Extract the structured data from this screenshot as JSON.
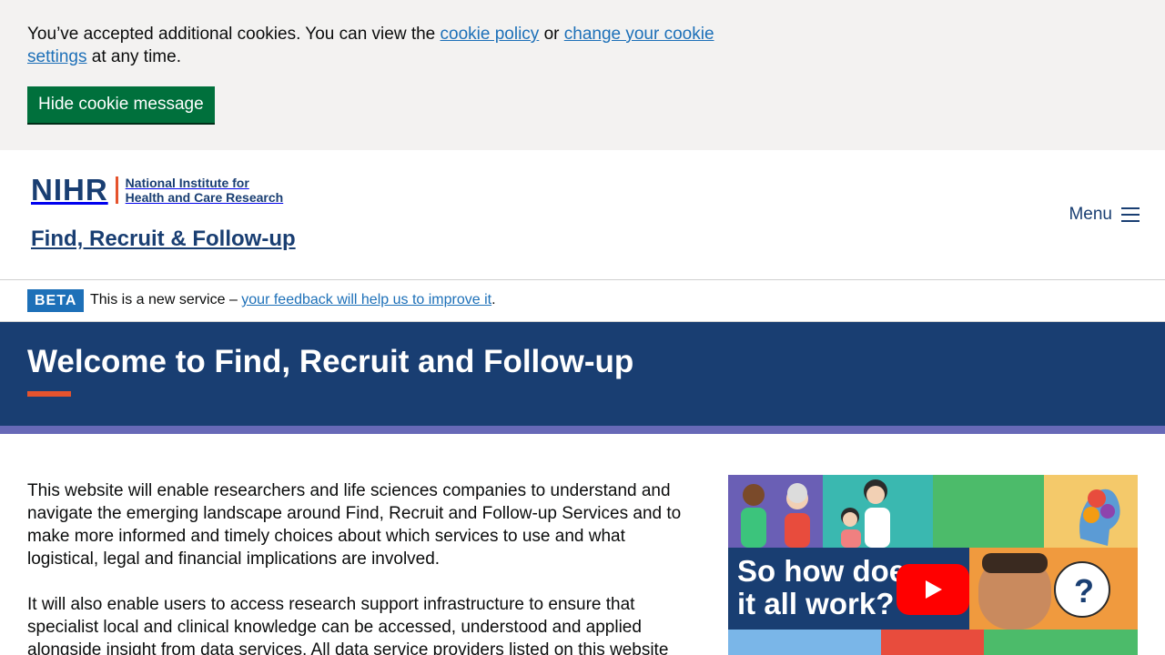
{
  "cookie_banner": {
    "text_before": "You’ve accepted additional cookies. You can view the ",
    "policy_link": "cookie policy",
    "text_middle": " or ",
    "settings_link": "change your cookie settings",
    "text_after": " at any time.",
    "hide_button": "Hide cookie message"
  },
  "header": {
    "logo_mark": "NIHR",
    "logo_line1": "National Institute for",
    "logo_line2": "Health and Care Research",
    "service_name": "Find, Recruit & Follow-up",
    "menu_label": "Menu"
  },
  "beta": {
    "tag": "BETA",
    "text": "This is a new service – ",
    "link": "your feedback will help us to improve it",
    "text_after": "."
  },
  "hero": {
    "title": "Welcome to Find, Recruit and Follow-up"
  },
  "main": {
    "paragraph1": "This website will enable researchers and life sciences companies to understand and navigate the emerging landscape around Find, Recruit and Follow-up Services and to make more informed and timely choices about which services to use and what logistical, legal and financial implications are involved.",
    "paragraph2": "It will also enable users to access research support infrastructure to ensure that specialist local and clinical knowledge can be accessed, understood and applied alongside insight from data services. All data service providers listed on this website"
  },
  "video": {
    "title_line1": "So how does",
    "title_line2": "it all work?"
  },
  "colors": {
    "nihr_navy": "#193e72",
    "accent_orange": "#e5532d",
    "link_blue": "#1d70b8",
    "button_green": "#00703c",
    "stripe_purple": "#6769b7"
  }
}
